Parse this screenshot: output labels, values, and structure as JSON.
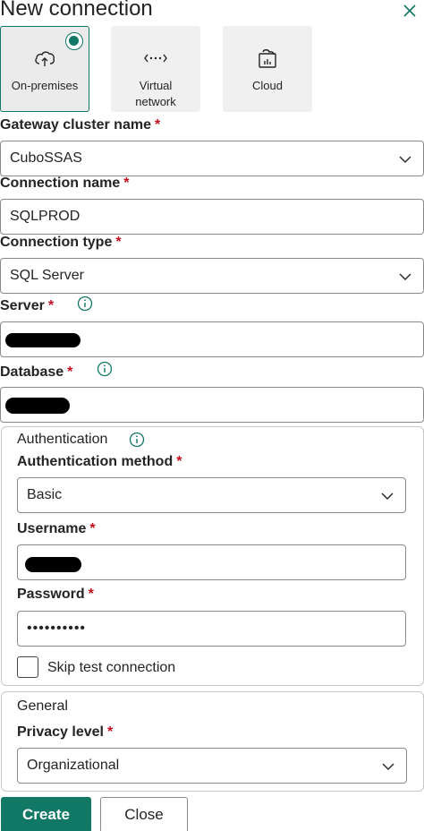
{
  "dialog": {
    "title": "New connection"
  },
  "tiles": [
    {
      "label": "On-premises",
      "icon": "cloud-upload-icon",
      "selected": true
    },
    {
      "label": "Virtual network",
      "icon": "network-arrows-icon",
      "selected": false
    },
    {
      "label": "Cloud",
      "icon": "cloud-report-icon",
      "selected": false
    }
  ],
  "fields": {
    "gateway_cluster": {
      "label": "Gateway cluster name",
      "value": "CuboSSAS"
    },
    "connection_name": {
      "label": "Connection name",
      "value": "SQLPROD"
    },
    "connection_type": {
      "label": "Connection type",
      "value": "SQL Server"
    },
    "server": {
      "label": "Server",
      "value": ""
    },
    "database": {
      "label": "Database",
      "value": ""
    }
  },
  "authentication": {
    "heading": "Authentication",
    "method": {
      "label": "Authentication method",
      "value": "Basic"
    },
    "username": {
      "label": "Username",
      "value": ""
    },
    "password": {
      "label": "Password",
      "value": "••••••••••"
    },
    "skip_test": {
      "label": "Skip test connection",
      "checked": false
    }
  },
  "general": {
    "heading": "General",
    "privacy": {
      "label": "Privacy level",
      "value": "Organizational"
    }
  },
  "buttons": {
    "create": "Create",
    "close": "Close"
  },
  "required_marker": "*",
  "colors": {
    "accent": "#117865",
    "required": "#c50f1f",
    "border": "#8a8a8a"
  }
}
